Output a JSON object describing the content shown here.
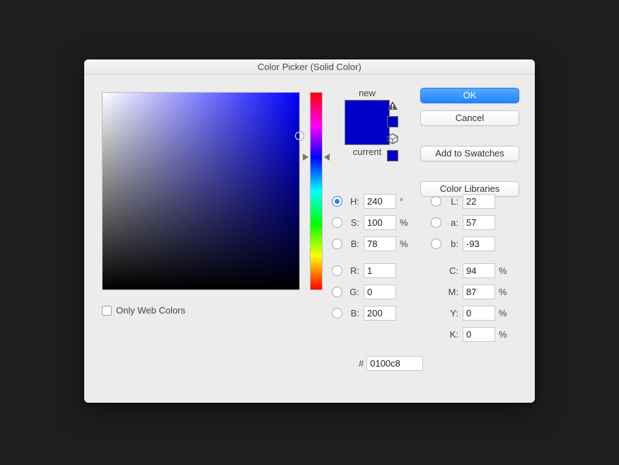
{
  "title": "Color Picker (Solid Color)",
  "buttons": {
    "ok": "OK",
    "cancel": "Cancel",
    "add_to_swatches": "Add to Swatches",
    "color_libraries": "Color Libraries"
  },
  "preview": {
    "new_label": "new",
    "current_label": "current",
    "new_color": "#0100c8",
    "current_color": "#0100c8"
  },
  "only_web_colors": {
    "label": "Only Web Colors",
    "checked": false
  },
  "hsb": {
    "h_label": "H:",
    "h_value": "240",
    "h_unit": "°",
    "s_label": "S:",
    "s_value": "100",
    "s_unit": "%",
    "b_label": "B:",
    "b_value": "78",
    "b_unit": "%",
    "selected": "H"
  },
  "rgb": {
    "r_label": "R:",
    "r_value": "1",
    "g_label": "G:",
    "g_value": "0",
    "b_label": "B:",
    "b_value": "200"
  },
  "lab": {
    "l_label": "L:",
    "l_value": "22",
    "a_label": "a:",
    "a_value": "57",
    "b_label": "b:",
    "b_value": "-93"
  },
  "cmyk": {
    "c_label": "C:",
    "c_value": "94",
    "unit": "%",
    "m_label": "M:",
    "m_value": "87",
    "y_label": "Y:",
    "y_value": "0",
    "k_label": "K:",
    "k_value": "0"
  },
  "hex": {
    "prefix": "#",
    "value": "0100c8"
  }
}
